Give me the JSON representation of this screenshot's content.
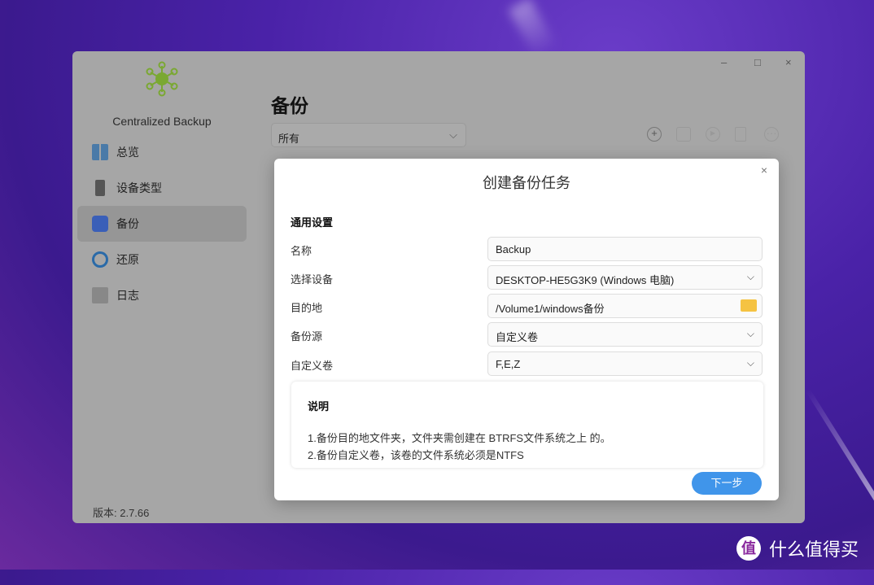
{
  "window": {
    "controls": [
      "–",
      "□",
      "×"
    ]
  },
  "sidebar": {
    "app_name": "Centralized Backup",
    "items": [
      {
        "label": "总览",
        "icon": "grid-icon"
      },
      {
        "label": "设备类型",
        "icon": "server-icon"
      },
      {
        "label": "备份",
        "icon": "backup-icon"
      },
      {
        "label": "还原",
        "icon": "restore-icon"
      },
      {
        "label": "日志",
        "icon": "log-icon"
      }
    ],
    "active": "备份",
    "version": "版本: 2.7.66"
  },
  "main": {
    "title": "备份",
    "filter": "所有",
    "toolbar": [
      "add-icon",
      "edit-icon",
      "play-icon",
      "trash-icon",
      "more-icon"
    ]
  },
  "dialog": {
    "title": "创建备份任务",
    "section": "通用设置",
    "fields": [
      {
        "label": "名称",
        "value": "Backup"
      },
      {
        "label": "选择设备",
        "value": "DESKTOP-HE5G3K9 (Windows 电脑)"
      },
      {
        "label": "目的地",
        "value": "/Volume1/windows备份"
      },
      {
        "label": "备份源",
        "value": "自定义卷"
      },
      {
        "label": "自定义卷",
        "value": "F,E,Z"
      }
    ],
    "note": {
      "title": "说明",
      "lines": [
        "1.备份目的地文件夹，文件夹需创建在 BTRFS文件系统之上 的。",
        "2.备份自定义卷，该卷的文件系统必须是NTFS"
      ]
    },
    "next": "下一步"
  },
  "watermark": {
    "badge": "值",
    "text": "什么值得买"
  },
  "colors": {
    "accent": "#4095ea",
    "logo": "#7aa832"
  }
}
